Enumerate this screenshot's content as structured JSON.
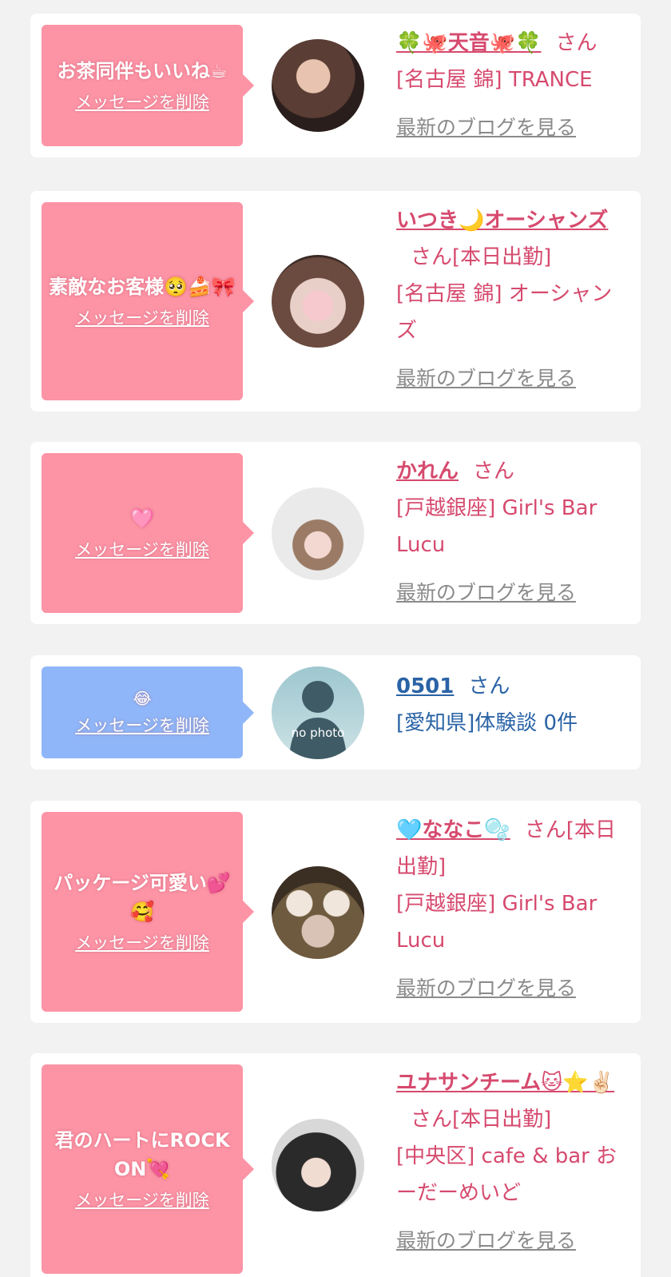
{
  "delete_label": "メッセージを削除",
  "san_label": "さん",
  "blog_label": "最新のブログを見る",
  "colors": {
    "pink_bubble": "#fc94a6",
    "blue_bubble": "#8fb6f8",
    "pink_text": "#d64a6e",
    "blue_text": "#2a63a6",
    "link_gray": "#8a8a8a"
  },
  "cards": [
    {
      "message": "お茶同伴もいいね☕",
      "name": "🍀🐙天音🐙🍀",
      "status": "",
      "shop": "[名古屋 錦] TRANCE",
      "avatar_icon": "profile-photo-icon"
    },
    {
      "message": "素敵なお客様🥺🍰🎀",
      "name": "いつき🌙オーシャンズ",
      "status": "[本日出勤]",
      "shop": "[名古屋 錦] オーシャンズ",
      "avatar_icon": "profile-photo-icon"
    },
    {
      "message": "🩷",
      "name": "かれん",
      "status": "",
      "shop": "[戸越銀座] Girl's Bar Lucu",
      "avatar_icon": "profile-photo-icon"
    },
    {
      "message": "😂",
      "name": "0501",
      "status": "",
      "shop": "[愛知県]体験談 0件",
      "avatar_text": "no photo",
      "avatar_icon": "no-photo-silhouette-icon"
    },
    {
      "message": "パッケージ可愛い💕🥰",
      "name": "🩵ななこ🫧",
      "status": "[本日出勤]",
      "shop": "[戸越銀座] Girl's Bar Lucu",
      "avatar_icon": "profile-photo-icon"
    },
    {
      "message": "君のハートにROCK ON💘",
      "name": "ユナサンチーム🐱⭐✌🏻",
      "status": "[本日出勤]",
      "shop": "[中央区] cafe & bar おーだーめいど",
      "avatar_icon": "profile-photo-icon"
    }
  ]
}
